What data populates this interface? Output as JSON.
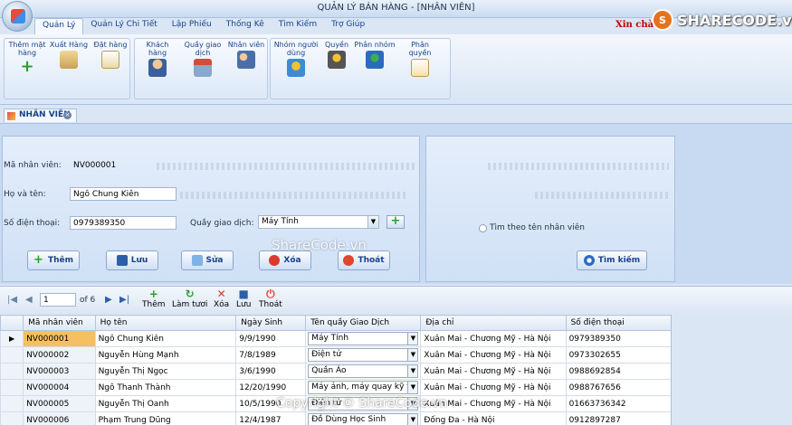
{
  "window_title": "QUẢN LÝ BÁN HÀNG - [NHÂN VIÊN]",
  "greeting": "Xin chà",
  "brand": {
    "icon_letter": "S",
    "name": "SHARECODE.vn"
  },
  "menu_tabs": [
    "Quản Lý",
    "Quản Lý Chi Tiết",
    "Lập Phiếu",
    "Thống Kê",
    "Tìm Kiếm",
    "Trợ Giúp"
  ],
  "ribbon": {
    "g1": [
      "Thêm mặt hàng",
      "Xuất Hàng",
      "Đặt hàng"
    ],
    "g2": [
      "Khách hàng",
      "Quầy giao dịch",
      "Nhân viên"
    ],
    "g3": [
      "Nhóm người dùng",
      "Quyền",
      "Phân nhóm",
      "Phân quyền"
    ]
  },
  "doc_tab": "NHÂN VIÊN",
  "form": {
    "manv_label": "Mã nhân viên:",
    "manv_value": "NV000001",
    "hoten_label": "Họ và tên:",
    "hoten_value": "Ngô Chung Kiên",
    "sdt_label": "Số điện thoại:",
    "sdt_value": "0979389350",
    "quay_label": "Quầy giao dịch:",
    "quay_value": "Máy Tính"
  },
  "buttons": {
    "them": "Thêm",
    "luu": "Lưu",
    "sua": "Sửa",
    "xoa": "Xóa",
    "thoat": "Thoát"
  },
  "search": {
    "radio_label": "Tìm theo tên nhân viên",
    "button": "Tìm kiếm"
  },
  "watermark": "ShareCode.vn",
  "watermark2": "Copyright © ShareCode.vn",
  "navigator": {
    "position": "1",
    "of_label": "of 6"
  },
  "toolbar": {
    "them": "Thêm",
    "lamtuoi": "Làm tươi",
    "xoa": "Xóa",
    "luu": "Lưu",
    "thoat": "Thoát"
  },
  "grid": {
    "columns": [
      "Mã nhân viên",
      "Họ tên",
      "Ngày Sinh",
      "Tên quầy Giao Dịch",
      "Địa chỉ",
      "Số điện thoại"
    ],
    "rows": [
      [
        "NV000001",
        "Ngô Chung Kiên",
        "9/9/1990",
        "Máy Tính",
        "Xuân Mai - Chương Mỹ - Hà Nội",
        "0979389350"
      ],
      [
        "NV000002",
        "Nguyễn Hùng Mạnh",
        "7/8/1989",
        "Điện tử",
        "Xuân Mai - Chương Mỹ - Hà Nội",
        "0973302655"
      ],
      [
        "NV000003",
        "Nguyễn Thị Ngọc",
        "3/6/1990",
        "Quần Áo",
        "Xuân Mai - Chương Mỹ - Hà Nội",
        "0988692854"
      ],
      [
        "NV000004",
        "Ngô Thanh Thành",
        "12/20/1990",
        "Máy ảnh, máy quay kỹ t...",
        "Xuân Mai - Chương Mỹ - Hà Nội",
        "0988767656"
      ],
      [
        "NV000005",
        "Nguyễn Thị Oanh",
        "10/5/1990",
        "Điện tử",
        "Xuân Mai - Chương Mỹ - Hà Nội",
        "01663736342"
      ],
      [
        "NV000006",
        "Phạm Trung Dũng",
        "12/4/1987",
        "Đồ Dùng Học Sinh",
        "Đống Đa - Hà Nội",
        "0912897287"
      ]
    ]
  }
}
